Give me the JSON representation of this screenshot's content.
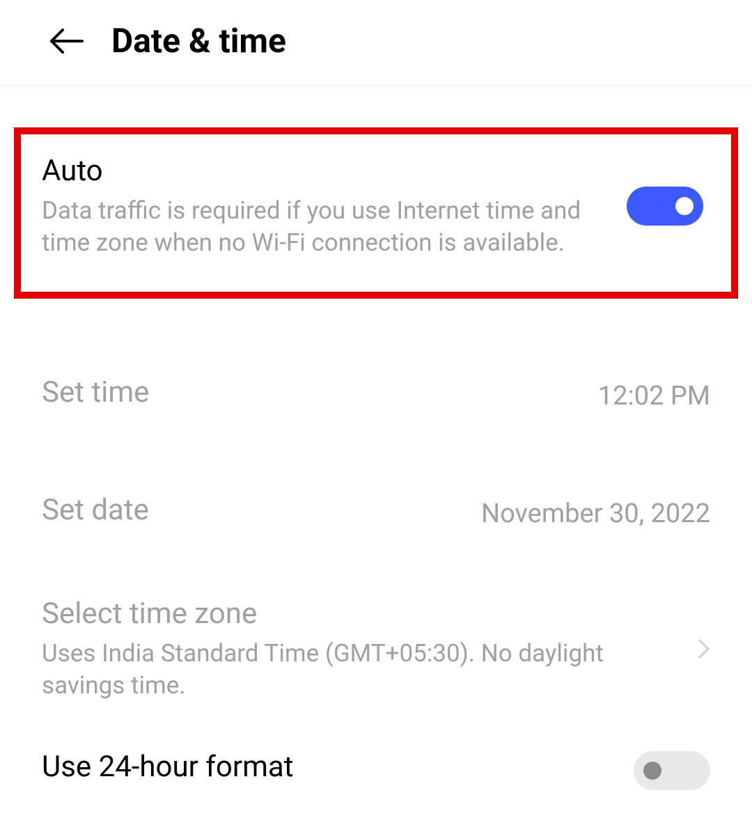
{
  "header": {
    "title": "Date & time"
  },
  "auto": {
    "title": "Auto",
    "description": "Data traffic is required if you use Internet time and time zone when no Wi-Fi connection is available.",
    "enabled": true
  },
  "set_time": {
    "label": "Set time",
    "value": "12:02 PM"
  },
  "set_date": {
    "label": "Set date",
    "value": "November 30, 2022"
  },
  "timezone": {
    "label": "Select time zone",
    "description": "Uses India Standard Time (GMT+05:30). No daylight savings time."
  },
  "format_24h": {
    "label": "Use 24-hour format",
    "enabled": false
  },
  "colors": {
    "highlight_border": "#e30000",
    "toggle_on": "#3b5bff",
    "toggle_off": "#e8e8e8",
    "disabled_text": "#a0a0a0"
  }
}
